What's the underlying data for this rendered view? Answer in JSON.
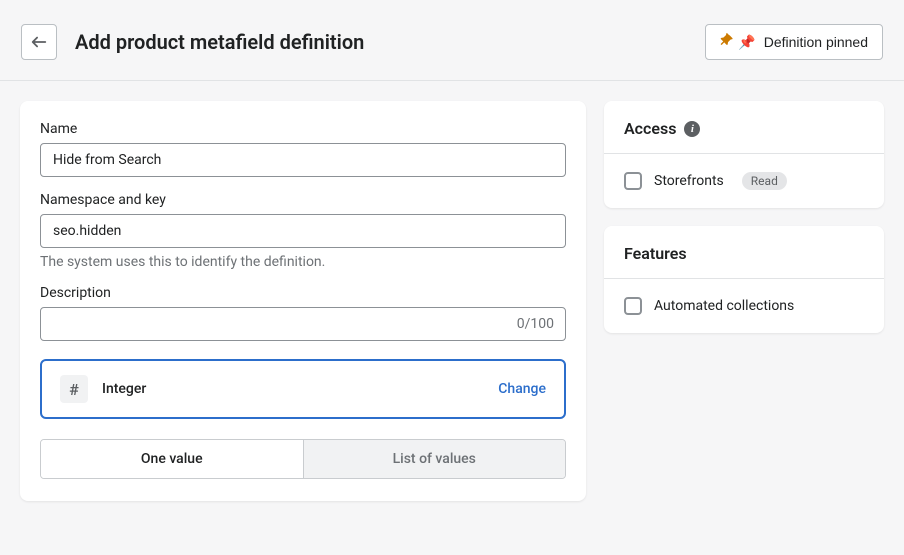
{
  "header": {
    "title": "Add product metafield definition",
    "pin_label": "Definition pinned"
  },
  "form": {
    "name_label": "Name",
    "name_value": "Hide from Search",
    "namespace_label": "Namespace and key",
    "namespace_value": "seo.hidden",
    "namespace_helper": "The system uses this to identify the definition.",
    "description_label": "Description",
    "description_value": "",
    "description_counter": "0/100",
    "type_name": "Integer",
    "type_icon_glyph": "#",
    "change_label": "Change",
    "segment_one": "One value",
    "segment_list": "List of values"
  },
  "access": {
    "title": "Access",
    "storefronts_label": "Storefronts",
    "storefronts_badge": "Read"
  },
  "features": {
    "title": "Features",
    "automated_label": "Automated collections"
  }
}
